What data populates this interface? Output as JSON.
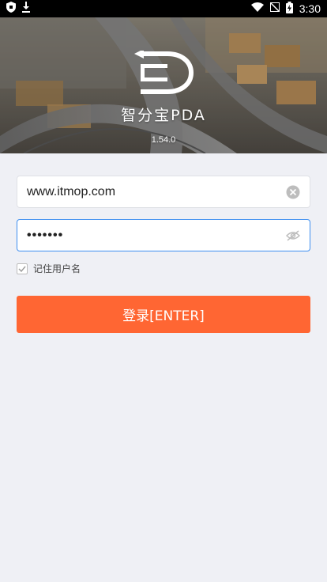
{
  "status_bar": {
    "time": "3:30",
    "left_icons": [
      "shield-icon",
      "download-icon"
    ],
    "right_icons": [
      "wifi-icon",
      "no-signal-icon",
      "battery-charging-icon"
    ]
  },
  "hero": {
    "brand": "智分宝PDA",
    "version": "1.54.0"
  },
  "form": {
    "username": "www.itmop.com",
    "password_masked": "•••••••",
    "remember_label": "记住用户名",
    "remember_checked": true,
    "login_label": "登录[ENTER]"
  },
  "colors": {
    "accent": "#ff6633",
    "focus_border": "#3d8ef0",
    "page_bg": "#eff0f5"
  }
}
